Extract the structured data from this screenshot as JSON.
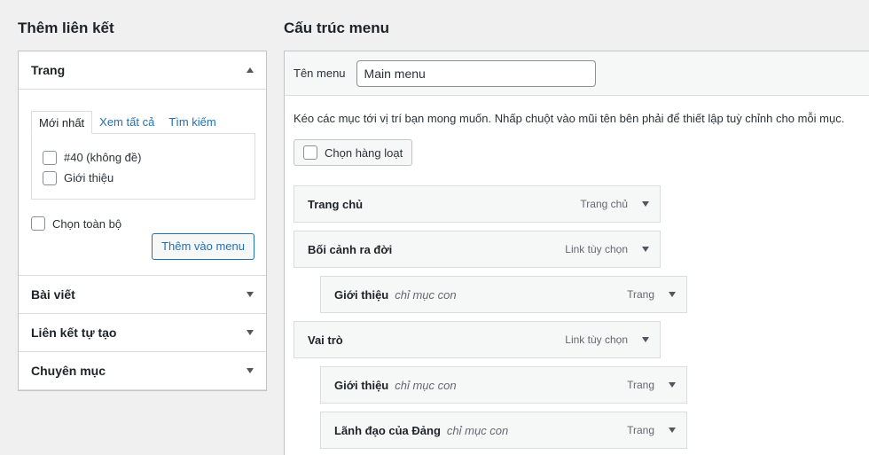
{
  "left": {
    "title": "Thêm liên kết",
    "pages_section": {
      "label": "Trang",
      "tabs": [
        {
          "label": "Mới nhất"
        },
        {
          "label": "Xem tất cả"
        },
        {
          "label": "Tìm kiếm"
        }
      ],
      "items": [
        {
          "label": "#40 (không đề)"
        },
        {
          "label": "Giới thiệu"
        }
      ],
      "select_all_label": "Chọn toàn bộ",
      "add_button_label": "Thêm vào menu"
    },
    "sections": [
      {
        "label": "Bài viết"
      },
      {
        "label": "Liên kết tự tạo"
      },
      {
        "label": "Chuyên mục"
      }
    ]
  },
  "right": {
    "title": "Cấu trúc menu",
    "menu_name_label": "Tên menu",
    "menu_name_value": "Main menu",
    "instructions": "Kéo các mục tới vị trí bạn mong muốn. Nhấp chuột vào mũi tên bên phải để thiết lập tuỳ chỉnh cho mỗi mục.",
    "bulk_select_label": "Chọn hàng loạt",
    "menu_items": [
      {
        "title": "Trang chủ",
        "sub": "",
        "type": "Trang chủ"
      },
      {
        "title": "Bối cảnh ra đời",
        "sub": "",
        "type": "Link tùy chọn"
      },
      {
        "title": "Giới thiệu",
        "sub": "chỉ mục con",
        "type": "Trang"
      },
      {
        "title": "Vai trò",
        "sub": "",
        "type": "Link tùy chọn"
      },
      {
        "title": "Giới thiệu",
        "sub": "chỉ mục con",
        "type": "Trang"
      },
      {
        "title": "Lãnh đạo của Đảng",
        "sub": "chỉ mục con",
        "type": "Trang"
      }
    ]
  },
  "colors": {
    "accent": "#2271b1",
    "background": "#f0f0f1",
    "border": "#c3c4c7"
  }
}
